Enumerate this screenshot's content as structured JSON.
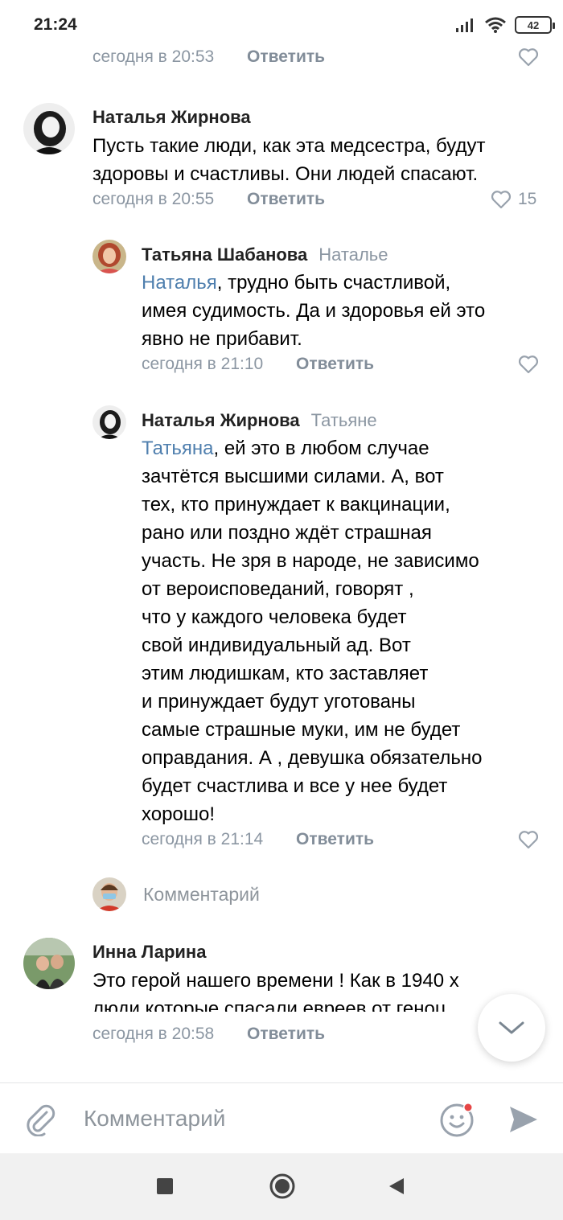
{
  "status_bar": {
    "time": "21:24",
    "battery": "42"
  },
  "comments": [
    {
      "time": "сегодня в 20:53",
      "reply": "Ответить",
      "likes": ""
    },
    {
      "author": "Наталья Жирнова",
      "lines": [
        "Пусть такие люди, как эта медсестра,  будут",
        "здоровы и счастливы. Они людей спасают."
      ],
      "time": "сегодня в 20:55",
      "reply": "Ответить",
      "likes": "15"
    },
    {
      "author": "Татьяна Шабанова",
      "to": "Наталье",
      "mention": "Наталья",
      "first_line": ", трудно быть счастливой,",
      "lines": [
        "имея судимость. Да и здоровья ей это",
        "явно не прибавит."
      ],
      "time": "сегодня в 21:10",
      "reply": "Ответить"
    },
    {
      "author": "Наталья Жирнова",
      "to": "Татьяне",
      "mention": "Татьяна",
      "first_line": ", ей это в любом случае",
      "lines": [
        "зачтётся высшими силами. А, вот",
        "тех, кто принуждает к вакцинации,",
        "рано или поздно ждёт страшная",
        "участь. Не зря в народе, не зависимо",
        "от вероисповеданий, говорят ,",
        "что у каждого человека будет",
        "свой индивидуальный ад. Вот",
        "этим людишкам, кто заставляет",
        "и принуждает будут уготованы",
        "самые страшные муки, им не будет",
        "оправдания. А , девушка обязательно",
        "будет счастлива и все у нее будет",
        "хорошо!"
      ],
      "time": "сегодня в 21:14",
      "reply": "Ответить"
    },
    {
      "author": "Инна Ларина",
      "lines": [
        "Это герой нашего времени ! Как в 1940 х",
        "люди которые спасали евреев от геноц"
      ],
      "time": "сегодня в 20:58",
      "reply": "Ответить"
    }
  ],
  "reply_box": {
    "placeholder": "Комментарий"
  },
  "composer": {
    "placeholder": "Комментарий"
  },
  "colors": {
    "link": "#4f7fae",
    "meta": "#8b96a2",
    "notification": "#e64646"
  },
  "icons": [
    "heart-icon",
    "chevron-down-icon",
    "paperclip-icon",
    "emoji-icon",
    "send-icon",
    "square-icon",
    "circle-icon",
    "back-triangle-icon"
  ]
}
